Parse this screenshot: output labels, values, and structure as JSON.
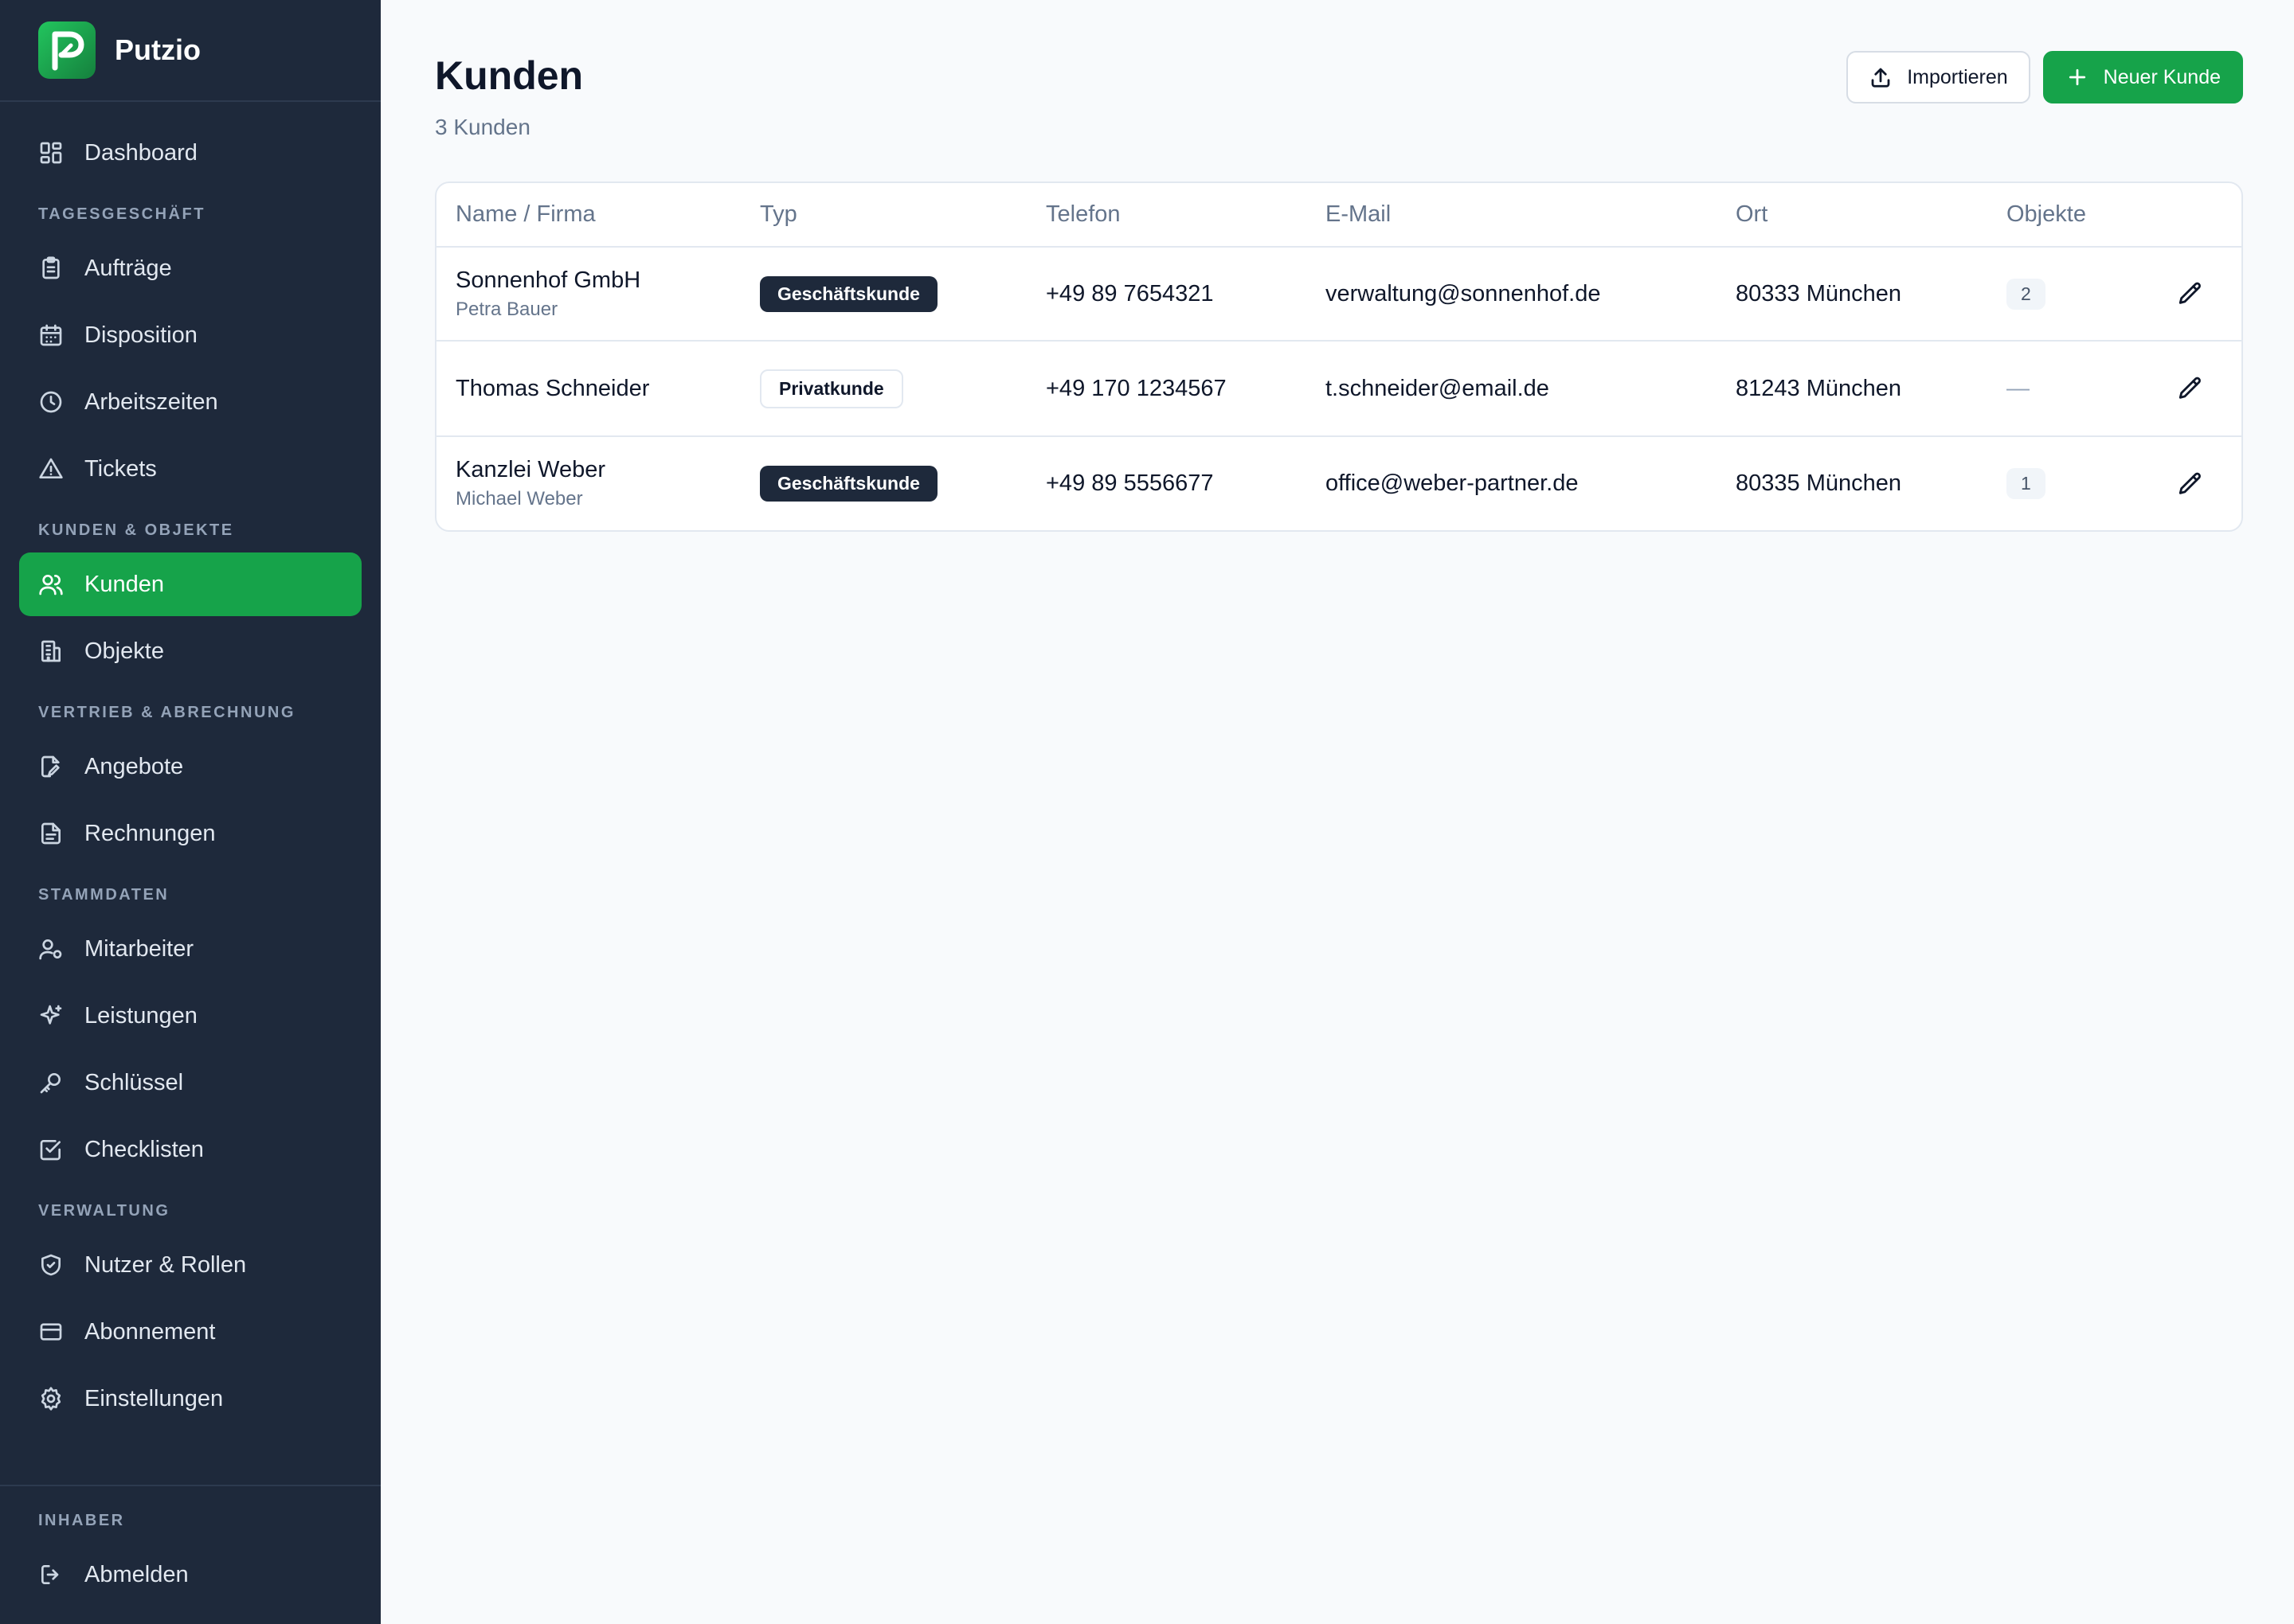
{
  "brand": {
    "name": "Putzio",
    "logo_letter": "P",
    "accent": "#16a34a"
  },
  "sidebar": {
    "top": [
      {
        "label": "Dashboard",
        "icon": "dashboard-icon"
      }
    ],
    "sections": [
      {
        "title": "TAGESGESCHÄFT",
        "items": [
          {
            "label": "Aufträge",
            "icon": "clipboard-icon"
          },
          {
            "label": "Disposition",
            "icon": "calendar-icon"
          },
          {
            "label": "Arbeitszeiten",
            "icon": "clock-icon"
          },
          {
            "label": "Tickets",
            "icon": "warning-icon"
          }
        ]
      },
      {
        "title": "KUNDEN & OBJEKTE",
        "items": [
          {
            "label": "Kunden",
            "icon": "users-icon",
            "active": true
          },
          {
            "label": "Objekte",
            "icon": "building-icon"
          }
        ]
      },
      {
        "title": "VERTRIEB & ABRECHNUNG",
        "items": [
          {
            "label": "Angebote",
            "icon": "edit-document-icon"
          },
          {
            "label": "Rechnungen",
            "icon": "document-icon"
          }
        ]
      },
      {
        "title": "STAMMDATEN",
        "items": [
          {
            "label": "Mitarbeiter",
            "icon": "user-settings-icon"
          },
          {
            "label": "Leistungen",
            "icon": "sparkles-icon"
          },
          {
            "label": "Schlüssel",
            "icon": "key-icon"
          },
          {
            "label": "Checklisten",
            "icon": "checkbox-icon"
          }
        ]
      },
      {
        "title": "VERWALTUNG",
        "items": [
          {
            "label": "Nutzer & Rollen",
            "icon": "shield-icon"
          },
          {
            "label": "Abonnement",
            "icon": "credit-card-icon"
          },
          {
            "label": "Einstellungen",
            "icon": "gear-icon"
          }
        ]
      }
    ],
    "footer": {
      "title": "INHABER",
      "logout_label": "Abmelden"
    }
  },
  "header": {
    "title": "Kunden",
    "subtitle": "3 Kunden",
    "import_label": "Importieren",
    "new_label": "Neuer Kunde"
  },
  "table": {
    "columns": [
      "Name / Firma",
      "Typ",
      "Telefon",
      "E-Mail",
      "Ort",
      "Objekte"
    ],
    "rows": [
      {
        "name": "Sonnenhof GmbH",
        "contact": "Petra Bauer",
        "type": "Geschäftskunde",
        "type_style": "dark",
        "phone": "+49 89 7654321",
        "email": "verwaltung@sonnenhof.de",
        "city": "80333 München",
        "objects": "2"
      },
      {
        "name": "Thomas Schneider",
        "contact": "",
        "type": "Privatkunde",
        "type_style": "light",
        "phone": "+49 170 1234567",
        "email": "t.schneider@email.de",
        "city": "81243 München",
        "objects": "—"
      },
      {
        "name": "Kanzlei Weber",
        "contact": "Michael Weber",
        "type": "Geschäftskunde",
        "type_style": "dark",
        "phone": "+49 89 5556677",
        "email": "office@weber-partner.de",
        "city": "80335 München",
        "objects": "1"
      }
    ]
  }
}
